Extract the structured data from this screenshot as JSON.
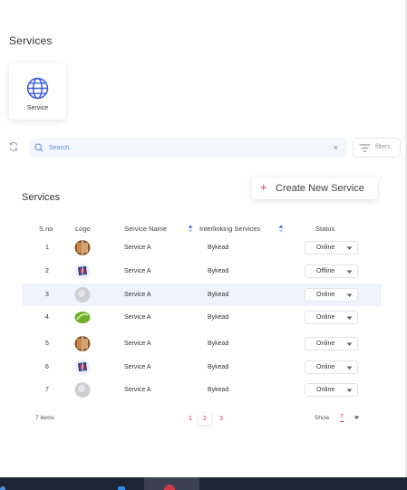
{
  "page": {
    "title": "Services"
  },
  "service_card": {
    "label": "Service",
    "icon": "globe-icon"
  },
  "search": {
    "placeholder": "Search",
    "clear": "×"
  },
  "filters": {
    "label": "filters"
  },
  "section": {
    "title": "Services"
  },
  "create_button": {
    "plus": "+",
    "label": "Create New Service"
  },
  "table": {
    "headers": {
      "sno": "S.no",
      "logo": "Logo",
      "name": "Service Name",
      "link": "Interlinking Services",
      "status": "Status"
    },
    "rows": [
      {
        "sno": "1",
        "logo": "logo-brown",
        "name": "Service A",
        "link": "Bykead",
        "status": "Online"
      },
      {
        "sno": "2",
        "logo": "logo-flag",
        "name": "Service A",
        "link": "Bykead",
        "status": "Offline"
      },
      {
        "sno": "3",
        "logo": "logo-grey",
        "name": "Service A",
        "link": "Bykead",
        "status": "Online"
      },
      {
        "sno": "4",
        "logo": "logo-green",
        "name": "Service A",
        "link": "Bykead",
        "status": "Online"
      },
      {
        "sno": "5",
        "logo": "logo-brown",
        "name": "Service A",
        "link": "Bykead",
        "status": "Online"
      },
      {
        "sno": "6",
        "logo": "logo-flag",
        "name": "Service A",
        "link": "Bykead",
        "status": "Online"
      },
      {
        "sno": "7",
        "logo": "logo-grey",
        "name": "Service A",
        "link": "Bykead",
        "status": "Online"
      }
    ]
  },
  "footer": {
    "items_count": "7 items",
    "pages": [
      "1",
      "2",
      "3"
    ],
    "show_label": "Show",
    "show_value": "7"
  },
  "colors": {
    "accent": "#e2354f",
    "globe": "#3b5bdb",
    "highlight": "#eef3fc",
    "search_bg": "#f2f6fd"
  }
}
